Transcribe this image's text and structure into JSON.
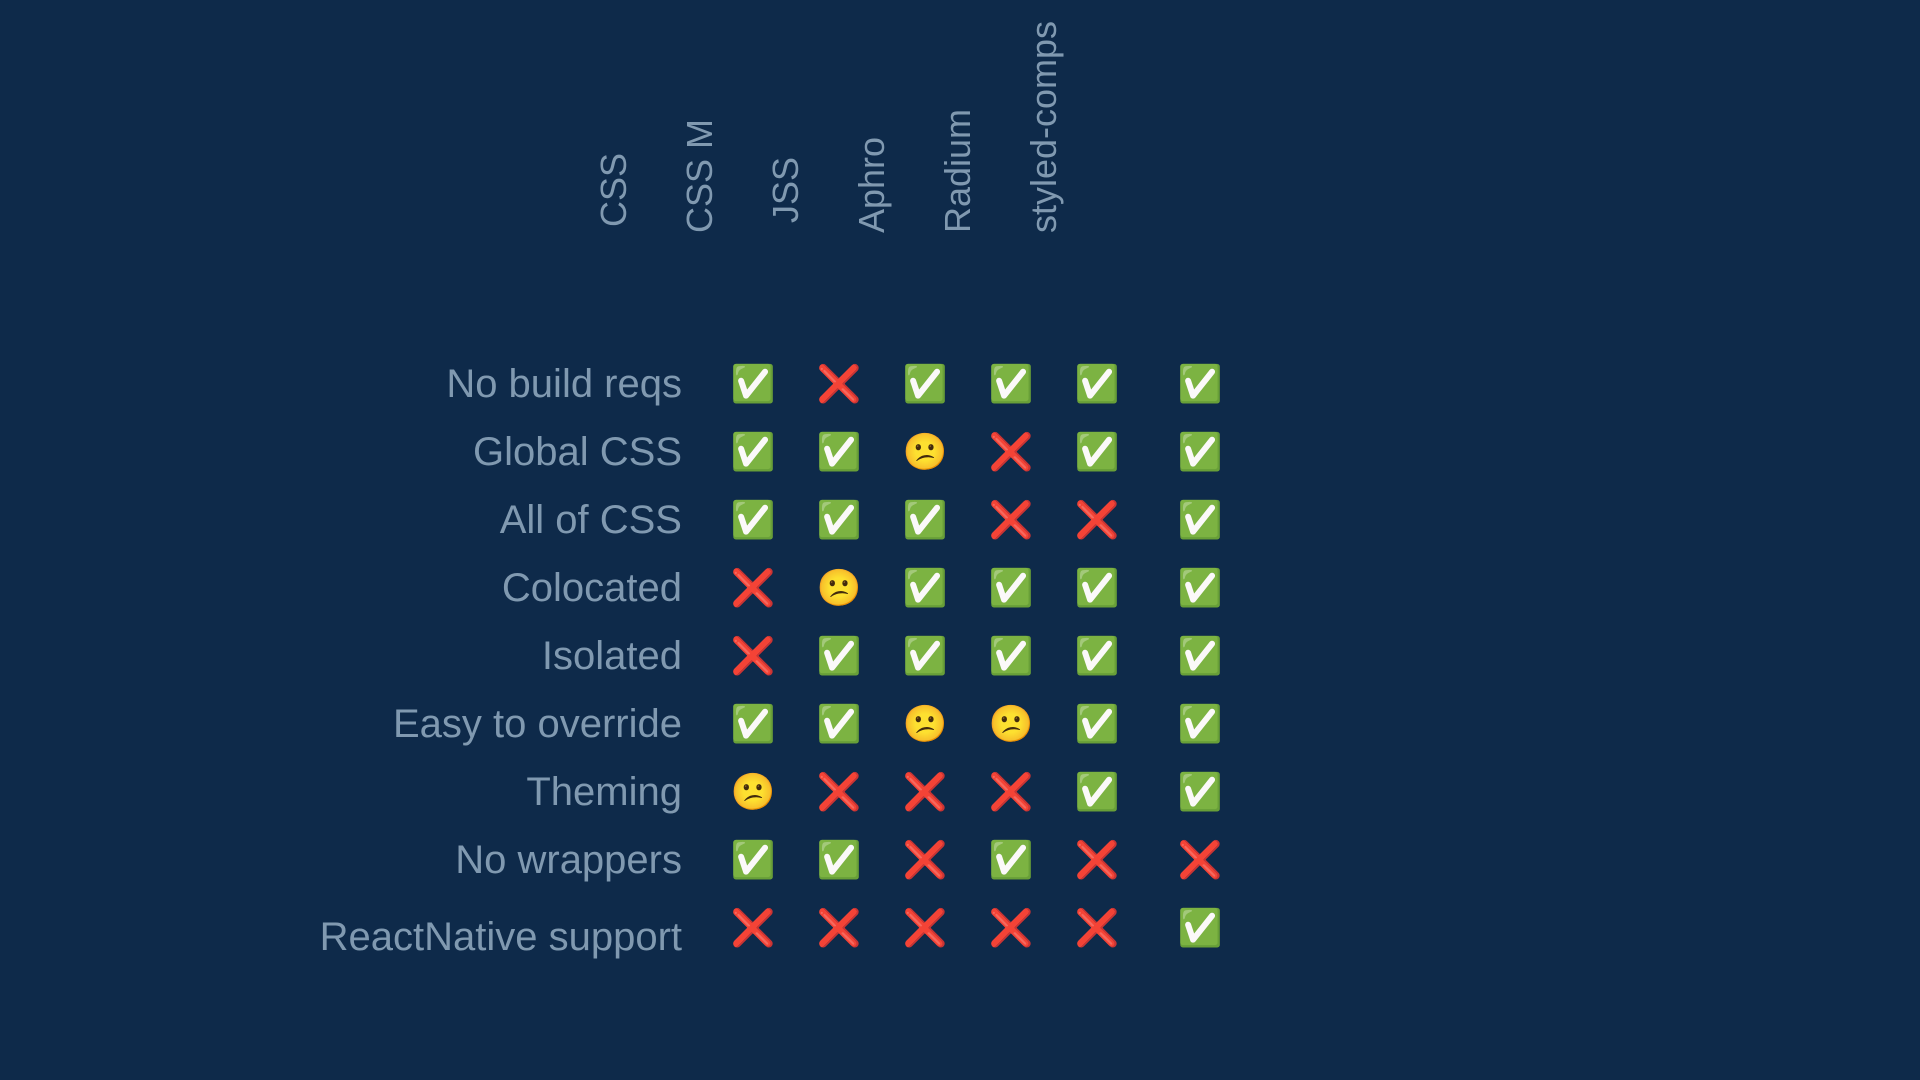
{
  "chart_data": {
    "type": "table",
    "title": "",
    "columns": [
      "CSS",
      "CSS M",
      "JSS",
      "Aphro",
      "Radium",
      "styled-comps"
    ],
    "rows": [
      {
        "label": "No build reqs",
        "values": [
          "yes",
          "no",
          "yes",
          "yes",
          "yes",
          "yes"
        ]
      },
      {
        "label": "Global CSS",
        "values": [
          "yes",
          "yes",
          "meh",
          "no",
          "yes",
          "yes"
        ]
      },
      {
        "label": "All of CSS",
        "values": [
          "yes",
          "yes",
          "yes",
          "no",
          "no",
          "yes"
        ]
      },
      {
        "label": "Colocated",
        "values": [
          "no",
          "meh",
          "yes",
          "yes",
          "yes",
          "yes"
        ]
      },
      {
        "label": "Isolated",
        "values": [
          "no",
          "yes",
          "yes",
          "yes",
          "yes",
          "yes"
        ]
      },
      {
        "label": "Easy to override",
        "values": [
          "yes",
          "yes",
          "meh",
          "meh",
          "yes",
          "yes"
        ]
      },
      {
        "label": "Theming",
        "values": [
          "meh",
          "no",
          "no",
          "no",
          "yes",
          "yes"
        ]
      },
      {
        "label": "No wrappers",
        "values": [
          "yes",
          "yes",
          "no",
          "yes",
          "no",
          "no"
        ]
      },
      {
        "label": "ReactNative support",
        "values": [
          "no",
          "no",
          "no",
          "no",
          "no",
          "yes"
        ]
      }
    ],
    "legend": {
      "yes": "✅",
      "no": "❌",
      "meh": "😕"
    }
  },
  "icons": {
    "yes": "✅",
    "no": "❌",
    "meh": "😕"
  }
}
